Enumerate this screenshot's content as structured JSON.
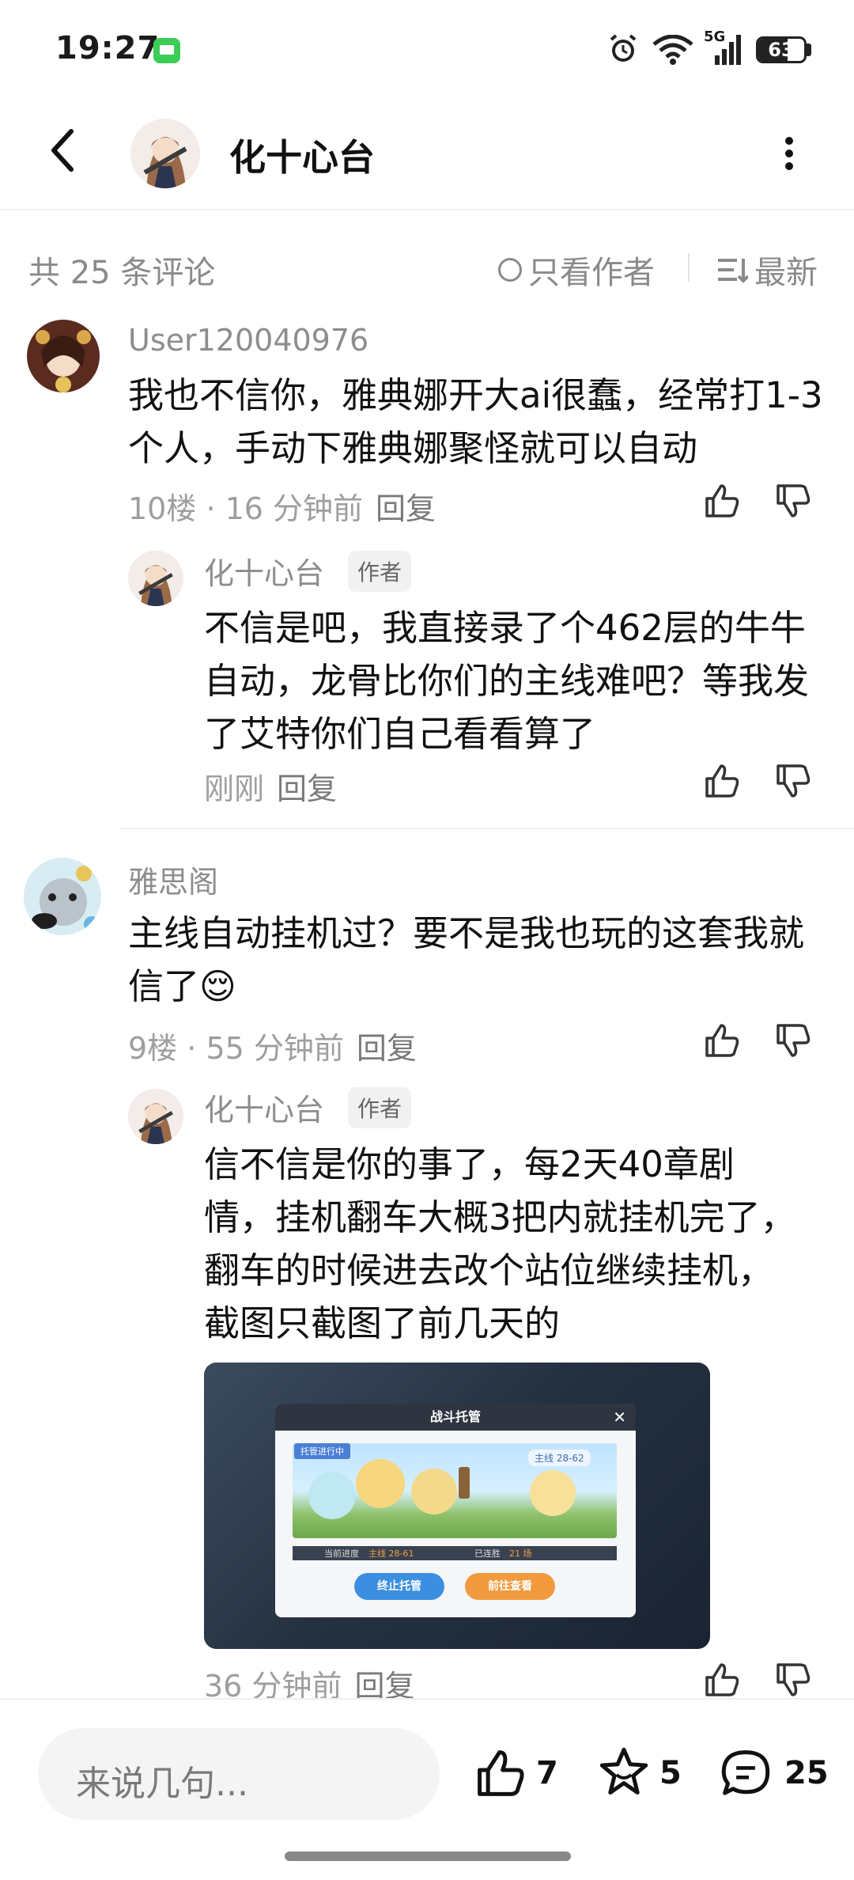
{
  "status_bar": {
    "time": "19:27",
    "network": "5G",
    "battery_level": "63",
    "battery_fraction": 0.63
  },
  "header": {
    "title": "化十心台",
    "back_icon": "chevron-left-icon",
    "more_icon": "more-vertical-icon"
  },
  "sort_bar": {
    "count_label": "共 25 条评论",
    "only_author_label": "只看作者",
    "sort_label": "最新"
  },
  "comments": [
    {
      "user": "User120040976",
      "content": "我也不信你，雅典娜开大ai很蠢，经常打1-3个人，手动下雅典娜聚怪就可以自动",
      "floor": "10楼",
      "time": "16 分钟前",
      "reply_label": "回复"
    },
    {
      "user": "雅思阁",
      "content": "主线自动挂机过？要不是我也玩的这套我就信了😌",
      "floor": "9楼",
      "time": "55 分钟前",
      "reply_label": "回复"
    }
  ],
  "replies": [
    {
      "user": "化十心台",
      "badge": "作者",
      "content": "不信是吧，我直接录了个462层的牛牛自动，龙骨比你们的主线难吧？等我发了艾特你们自己看看算了",
      "time": "刚刚",
      "reply_label": "回复"
    },
    {
      "user": "化十心台",
      "badge": "作者",
      "content": "信不信是你的事了，每2天40章剧情，挂机翻车大概3把内就挂机完了，翻车的时候进去改个站位继续挂机，截图只截图了前几天的",
      "time": "36 分钟前",
      "reply_label": "回复"
    }
  ],
  "attached_image": {
    "dialog_title": "战斗托管",
    "status_tag": "托管进行中",
    "stage_tag": "主线 28-62",
    "progress_label": "当前进度",
    "progress_value": "主线 28-61",
    "wins_label": "已连胜",
    "wins_value": "21 场",
    "stop_button": "终止托管",
    "view_button": "前往查看"
  },
  "bottom_bar": {
    "input_placeholder": "来说几句...",
    "likes": "7",
    "favorites": "5",
    "comments": "25"
  },
  "colors": {
    "meta_gray": "#9e9e9e",
    "text": "#111111",
    "badge_bg": "#f1f1f1",
    "input_bg": "#f4f4f4"
  }
}
